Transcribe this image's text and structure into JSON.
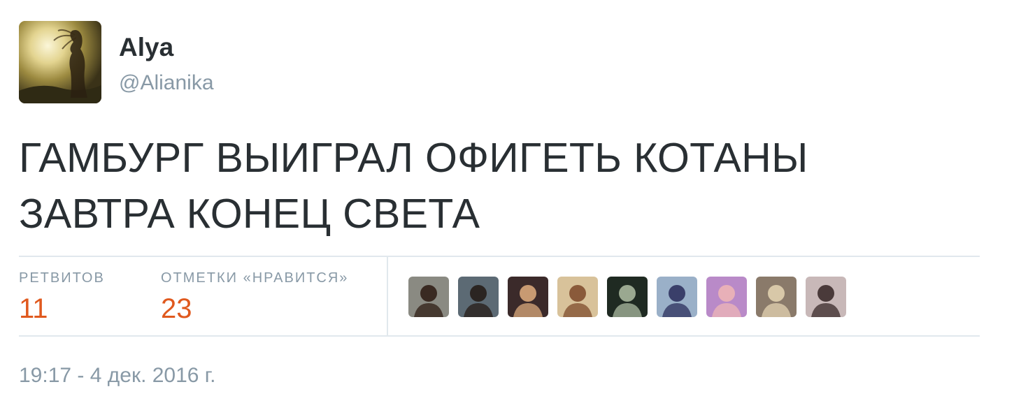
{
  "user": {
    "display_name": "Alya",
    "screen_name": "@Alianika"
  },
  "tweet": {
    "lines": [
      "ГАМБУРГ ВЫИГРАЛ ОФИГЕТЬ КОТАНЫ",
      "ЗАВТРА КОНЕЦ СВЕТА"
    ],
    "timestamp": "19:17 - 4 дек. 2016 г."
  },
  "stats": {
    "retweets_label": "РЕТВИТОВ",
    "retweets_count": "11",
    "likes_label": "ОТМЕТКИ «НРАВИТСЯ»",
    "likes_count": "23"
  },
  "likers": [
    {
      "name": "liker-avatar-1",
      "bg": "#8a8a82",
      "fg": "#3a2a22"
    },
    {
      "name": "liker-avatar-2",
      "bg": "#5c6a74",
      "fg": "#2b2522"
    },
    {
      "name": "liker-avatar-3",
      "bg": "#3b2a2a",
      "fg": "#c89a72"
    },
    {
      "name": "liker-avatar-4",
      "bg": "#d8c29a",
      "fg": "#8a5a3a"
    },
    {
      "name": "liker-avatar-5",
      "bg": "#1f2a22",
      "fg": "#9aa890"
    },
    {
      "name": "liker-avatar-6",
      "bg": "#9ab0c8",
      "fg": "#3a3f6a"
    },
    {
      "name": "liker-avatar-7",
      "bg": "#b98ac8",
      "fg": "#e8b0b8"
    },
    {
      "name": "liker-avatar-8",
      "bg": "#8a7a6a",
      "fg": "#d8c8a8"
    },
    {
      "name": "liker-avatar-9",
      "bg": "#c8b8b8",
      "fg": "#4a3a3a"
    }
  ],
  "colors": {
    "text": "#292f33",
    "muted": "#8899a6",
    "count": "#e0591e",
    "border": "#e1e8ed"
  }
}
